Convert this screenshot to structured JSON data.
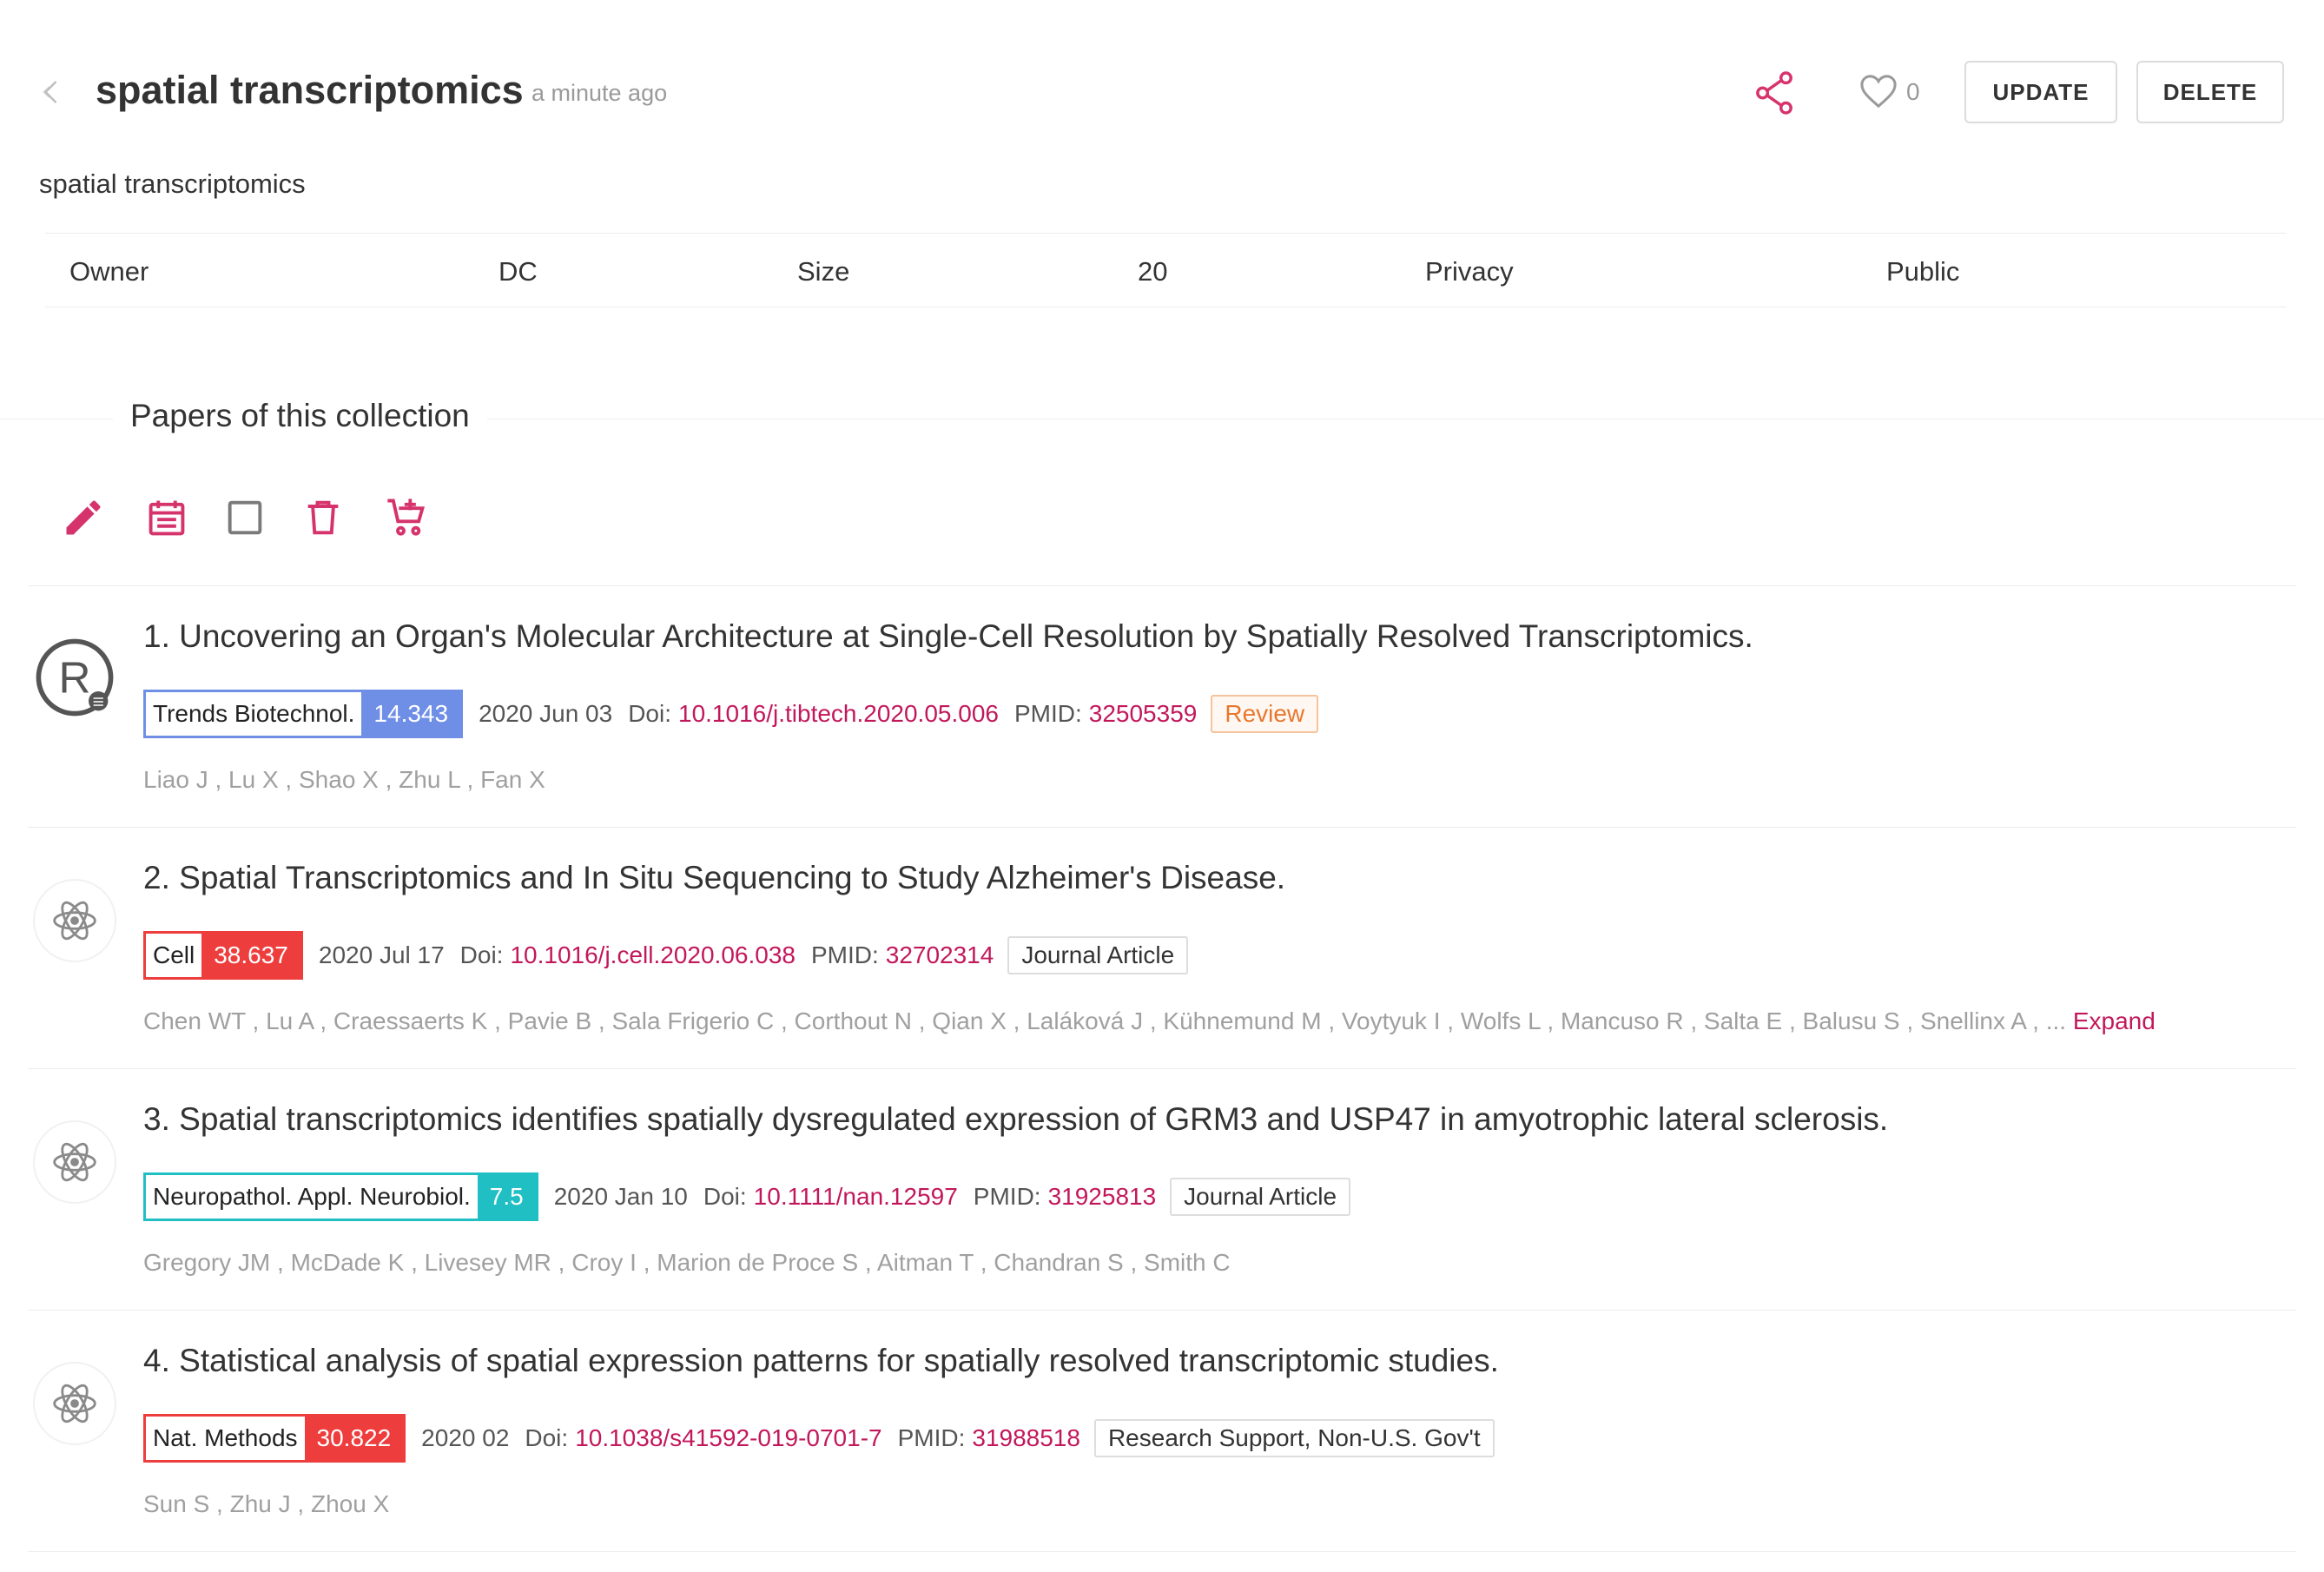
{
  "header": {
    "title": "spatial transcriptomics",
    "time_ago": "a minute ago",
    "like_count": "0",
    "update_label": "UPDATE",
    "delete_label": "DELETE"
  },
  "description": "spatial transcriptomics",
  "meta": {
    "owner_label": "Owner",
    "owner_value": "DC",
    "size_label": "Size",
    "size_value": "20",
    "privacy_label": "Privacy",
    "privacy_value": "Public"
  },
  "section": {
    "title": "Papers of this collection"
  },
  "toolbar": {
    "icons": [
      "pencil-icon",
      "calendar-icon",
      "checkbox-icon",
      "trash-icon",
      "cart-add-icon"
    ],
    "accent_color": "#d6336c"
  },
  "papers": [
    {
      "title": "1. Uncovering an Organ's Molecular Architecture at Single-Cell Resolution by Spatially Resolved Transcriptomics.",
      "journal": "Trends Biotechnol.",
      "impact_factor": "14.343",
      "journal_color": "#6f8ee6",
      "date": "2020 Jun 03",
      "doi_label": "Doi:",
      "doi": "10.1016/j.tibtech.2020.05.006",
      "pmid_label": "PMID:",
      "pmid": "32505359",
      "type": "Review",
      "authors": "Liao J , Lu X , Shao X , Zhu L , Fan X",
      "expand": ""
    },
    {
      "title": "2. Spatial Transcriptomics and In Situ Sequencing to Study Alzheimer's Disease.",
      "journal": "Cell",
      "impact_factor": "38.637",
      "journal_color": "#ee3d3d",
      "date": "2020 Jul 17",
      "doi_label": "Doi:",
      "doi": "10.1016/j.cell.2020.06.038",
      "pmid_label": "PMID:",
      "pmid": "32702314",
      "type": "Journal Article",
      "authors": "Chen WT , Lu A , Craessaerts K , Pavie B , Sala Frigerio C , Corthout N , Qian X , Laláková J , Kühnemund M , Voytyuk I , Wolfs L , Mancuso R , Salta E , Balusu S , Snellinx A , ...",
      "expand": "Expand"
    },
    {
      "title": "3. Spatial transcriptomics identifies spatially dysregulated expression of GRM3 and USP47 in amyotrophic lateral sclerosis.",
      "journal": "Neuropathol. Appl. Neurobiol.",
      "impact_factor": "7.5",
      "journal_color": "#1fbfc4",
      "date": "2020 Jan 10",
      "doi_label": "Doi:",
      "doi": "10.1111/nan.12597",
      "pmid_label": "PMID:",
      "pmid": "31925813",
      "type": "Journal Article",
      "authors": "Gregory JM , McDade K , Livesey MR , Croy I , Marion de Proce S , Aitman T , Chandran S , Smith C",
      "expand": ""
    },
    {
      "title": "4. Statistical analysis of spatial expression patterns for spatially resolved transcriptomic studies.",
      "journal": "Nat. Methods",
      "impact_factor": "30.822",
      "journal_color": "#ee3d3d",
      "date": "2020 02",
      "doi_label": "Doi:",
      "doi": "10.1038/s41592-019-0701-7",
      "pmid_label": "PMID:",
      "pmid": "31988518",
      "type": "Research Support, Non-U.S. Gov't",
      "authors": "Sun S , Zhu J , Zhou X",
      "expand": ""
    }
  ]
}
